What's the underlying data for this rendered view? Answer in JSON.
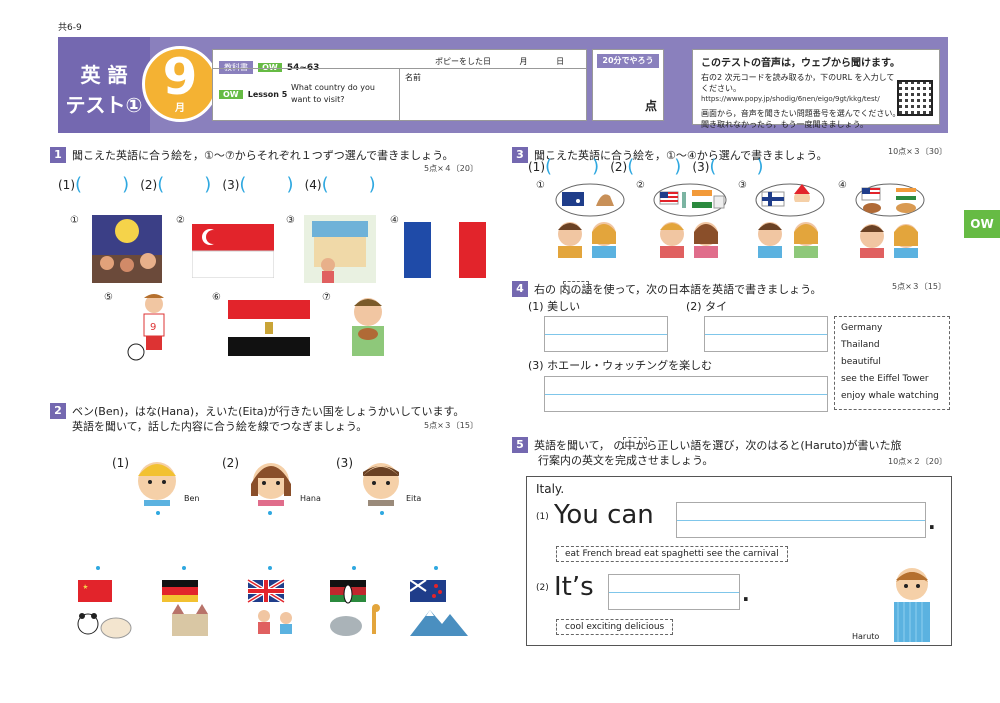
{
  "corner_label": "共6-9",
  "header": {
    "title_1": "英 語",
    "title_2": "テスト①",
    "month_num": "9",
    "month_suffix": "月",
    "textbook_tag": "教科書",
    "ow_tag": "OW",
    "pages": "54~63",
    "date_label": "ポピーをした日",
    "month_label": "月",
    "day_label": "日",
    "lesson_tag": "OW",
    "lesson": "Lesson 5",
    "lesson_title_1": "What country do you",
    "lesson_title_2": "want to visit?",
    "name_label": "名前",
    "time_badge": "20分でやろう",
    "score_label": "点",
    "audio_title": "このテストの音声は，ウェブから聞けます。",
    "audio_line1": "右の2 次元コードを読み取るか，下のURL を入力してください。",
    "audio_url": "https://www.popy.jp/shodig/6nen/eigo/9gt/kkg/test/",
    "audio_line2": "画面から，音声を聞きたい問題番号を選んでください。",
    "audio_line3": "聞き取れなかったら，もう一度聞きましょう。"
  },
  "side_tab": "OW",
  "q1": {
    "num": "1",
    "text": "聞こえた英語に合う絵を，①～⑦からそれぞれ１つずつ選んで書きましょう。",
    "points": "5点×４〔20〕",
    "answers": [
      "(1)",
      "(2)",
      "(3)",
      "(4)"
    ],
    "pic_nums": [
      "①",
      "②",
      "③",
      "④",
      "⑤",
      "⑥",
      "⑦"
    ]
  },
  "q2": {
    "num": "2",
    "text_1": "ベン(Ben)，はな(Hana)，えいた(Eita)が行きたい国をしょうかいしています。",
    "text_2": "英語を聞いて，話した内容に合う絵を線でつなぎましょう。",
    "points": "5点×３〔15〕",
    "people": [
      {
        "num": "(1)",
        "name": "Ben"
      },
      {
        "num": "(2)",
        "name": "Hana"
      },
      {
        "num": "(3)",
        "name": "Eita"
      }
    ]
  },
  "q3": {
    "num": "3",
    "text": "聞こえた英語に合う絵を，①～④から選んで書きましょう。",
    "points": "10点×３〔30〕",
    "answers": [
      "(1)",
      "(2)",
      "(3)"
    ],
    "pic_nums": [
      "①",
      "②",
      "③",
      "④"
    ]
  },
  "q4": {
    "num": "4",
    "text": "右の    内の語を使って，次の日本語を英語で書きましょう。",
    "points": "5点×３〔15〕",
    "item1": "(1) 美しい",
    "item2": "(2) タイ",
    "item3": "(3) ホエール・ウォッチングを楽しむ",
    "words": [
      "Germany",
      "Thailand",
      "beautiful",
      "see the Eiffel Tower",
      "enjoy whale watching"
    ]
  },
  "q5": {
    "num": "5",
    "text_1": "英語を聞いて，    の中から正しい語を選び，次のはると(Haruto)が書いた旅",
    "text_2": "行案内の英文を完成させましょう。",
    "points": "10点×２〔20〕",
    "country": "Italy.",
    "s1_num": "(1)",
    "s1": "You can",
    "s1_choices": "eat French bread      eat spaghetti      see the carnival",
    "s2_num": "(2)",
    "s2": "It’s",
    "s2_choices": "cool      exciting      delicious",
    "period": ".",
    "person": "Haruto"
  }
}
